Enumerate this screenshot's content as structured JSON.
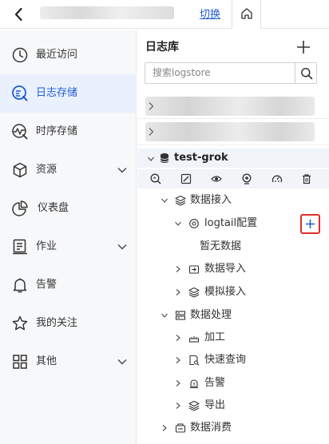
{
  "header": {
    "switch_label": "切换"
  },
  "sidebar": {
    "items": [
      {
        "label": "最近访问",
        "icon": "clock-icon"
      },
      {
        "label": "日志存储",
        "icon": "log-search-icon",
        "active": true
      },
      {
        "label": "时序存储",
        "icon": "metrics-icon"
      },
      {
        "label": "资源",
        "icon": "cube-icon",
        "expandable": true
      },
      {
        "label": "仪表盘",
        "icon": "pie-chart-icon"
      },
      {
        "label": "作业",
        "icon": "job-icon",
        "expandable": true
      },
      {
        "label": "告警",
        "icon": "bell-icon"
      },
      {
        "label": "我的关注",
        "icon": "star-icon"
      },
      {
        "label": "其他",
        "icon": "grid-icon",
        "expandable": true
      }
    ]
  },
  "panel": {
    "title": "日志库",
    "search_placeholder": "搜索logstore",
    "project_name": "test-grok",
    "tree": {
      "data_ingest": "数据接入",
      "logtail_config": "logtail配置",
      "no_data": "暂无数据",
      "data_import": "数据导入",
      "simulated_ingest": "模拟接入",
      "data_processing": "数据处理",
      "processing": "加工",
      "quick_query": "快速查询",
      "alert": "告警",
      "export": "导出",
      "data_consumption": "数据消费"
    }
  },
  "colors": {
    "accent": "#1f5bd6",
    "highlight_border": "#e02d2d",
    "sidebar_bg": "#f7f8fa",
    "active_bg": "#eaf1fc"
  }
}
